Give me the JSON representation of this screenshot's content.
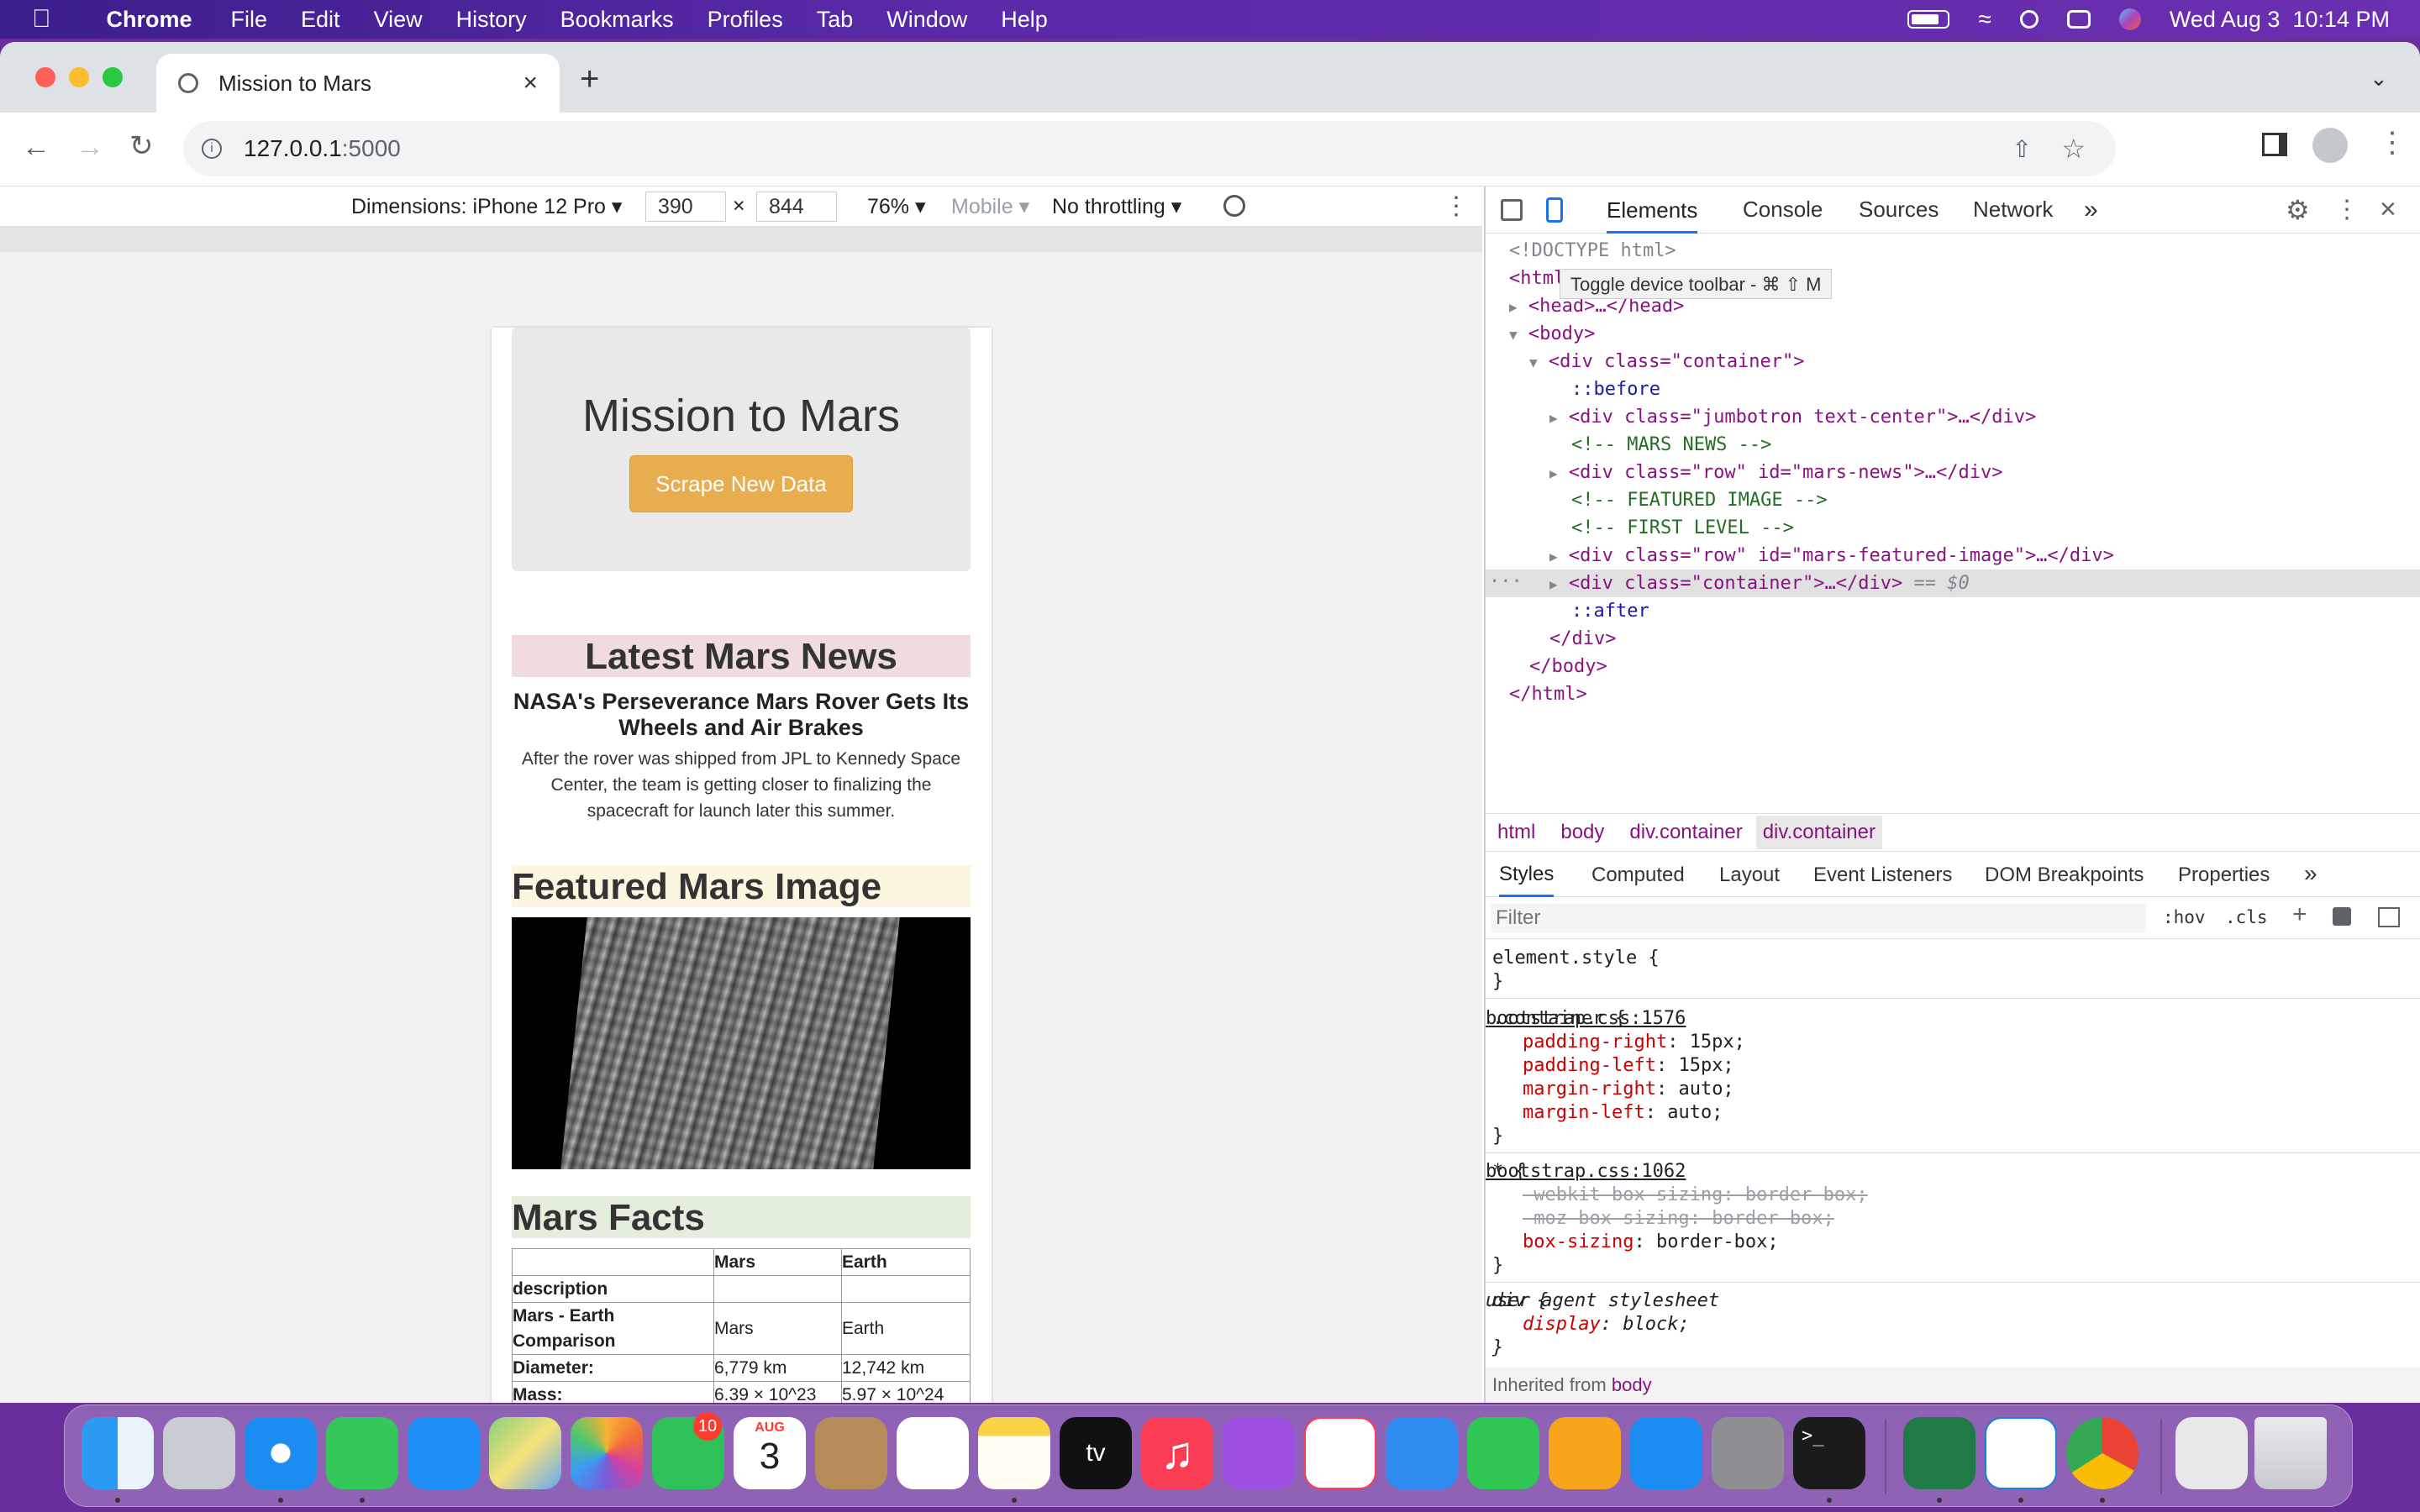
{
  "menubar": {
    "app_name": "Chrome",
    "items": [
      "File",
      "Edit",
      "View",
      "History",
      "Bookmarks",
      "Profiles",
      "Tab",
      "Window",
      "Help"
    ],
    "datetime": "Wed Aug 3  10:14 PM"
  },
  "browser": {
    "tab_title": "Mission to Mars",
    "url_host": "127.0.0.1",
    "url_port": ":5000"
  },
  "device_toolbar": {
    "dimensions": "Dimensions: iPhone 12 Pro",
    "width": "390",
    "x": "×",
    "height": "844",
    "zoom": "76%",
    "mode": "Mobile",
    "throttling": "No throttling"
  },
  "page": {
    "title": "Mission to Mars",
    "scrape_button": "Scrape New Data",
    "news_heading": "Latest Mars News",
    "news_title": "NASA's Perseverance Mars Rover Gets Its Wheels and Air Brakes",
    "news_paragraph": "After the rover was shipped from JPL to Kennedy Space Center, the team is getting closer to finalizing the spacecraft for launch later this summer.",
    "featured_heading": "Featured Mars Image",
    "facts_heading": "Mars Facts",
    "facts_table": {
      "headers": [
        "",
        "Mars",
        "Earth"
      ],
      "rows": [
        [
          "description",
          "",
          ""
        ],
        [
          "Mars - Earth Comparison",
          "Mars",
          "Earth"
        ],
        [
          "Diameter:",
          "6,779 km",
          "12,742 km"
        ],
        [
          "Mass:",
          "6.39 × 10^23",
          "5.97 × 10^24"
        ]
      ]
    }
  },
  "devtools": {
    "tabs": [
      "Elements",
      "Console",
      "Sources",
      "Network"
    ],
    "more": "»",
    "tooltip": "Toggle device toolbar - ⌘ ⇧ M",
    "dom": {
      "doctype": "<!DOCTYPE html>",
      "html_open": "<html lang=\"en\">",
      "head": "<head>…</head>",
      "body_open": "<body>",
      "container_open": "<div class=\"container\">",
      "before": "::before",
      "jumbotron": "<div class=\"jumbotron text-center\">…</div>",
      "c_news": "<!-- MARS NEWS -->",
      "mars_news": "<div class=\"row\" id=\"mars-news\">…</div>",
      "c_featured": "<!-- FEATURED IMAGE -->",
      "c_first": "<!-- FIRST LEVEL -->",
      "featured": "<div class=\"row\" id=\"mars-featured-image\">…</div>",
      "container_sel": "<div class=\"container\">…</div>",
      "sel_marker": "== $0",
      "after": "::after",
      "div_close": "</div>",
      "body_close": "</body>",
      "html_close": "</html>"
    },
    "breadcrumbs": [
      "html",
      "body",
      "div.container",
      "div.container"
    ],
    "style_tabs": [
      "Styles",
      "Computed",
      "Layout",
      "Event Listeners",
      "DOM Breakpoints",
      "Properties"
    ],
    "filter_placeholder": "Filter",
    "hov": ":hov",
    "cls": ".cls",
    "rules": {
      "element_style": "element.style {",
      "close": "}",
      "container_sel": ".container {",
      "container_src": "bootstrap.css:1576",
      "container_props": [
        {
          "name": "padding-right",
          "value": "15px;"
        },
        {
          "name": "padding-left",
          "value": "15px;"
        },
        {
          "name": "margin-right",
          "value": "auto;"
        },
        {
          "name": "margin-left",
          "value": "auto;"
        }
      ],
      "star_sel": "* {",
      "star_src": "bootstrap.css:1062",
      "star_props": [
        {
          "name": "-webkit-box-sizing",
          "value": "border-box;"
        },
        {
          "name": "-moz-box-sizing",
          "value": "border-box;"
        },
        {
          "name": "box-sizing",
          "value": "border-box;"
        }
      ],
      "div_sel": "div {",
      "div_src": "user agent stylesheet",
      "div_props": [
        {
          "name": "display",
          "value": "block;"
        }
      ],
      "inherited": "Inherited from",
      "inherited_from": "body"
    }
  },
  "dock": {
    "calendar_month": "AUG",
    "calendar_day": "3",
    "facetime_badge": "10",
    "tv_label": "tv"
  }
}
